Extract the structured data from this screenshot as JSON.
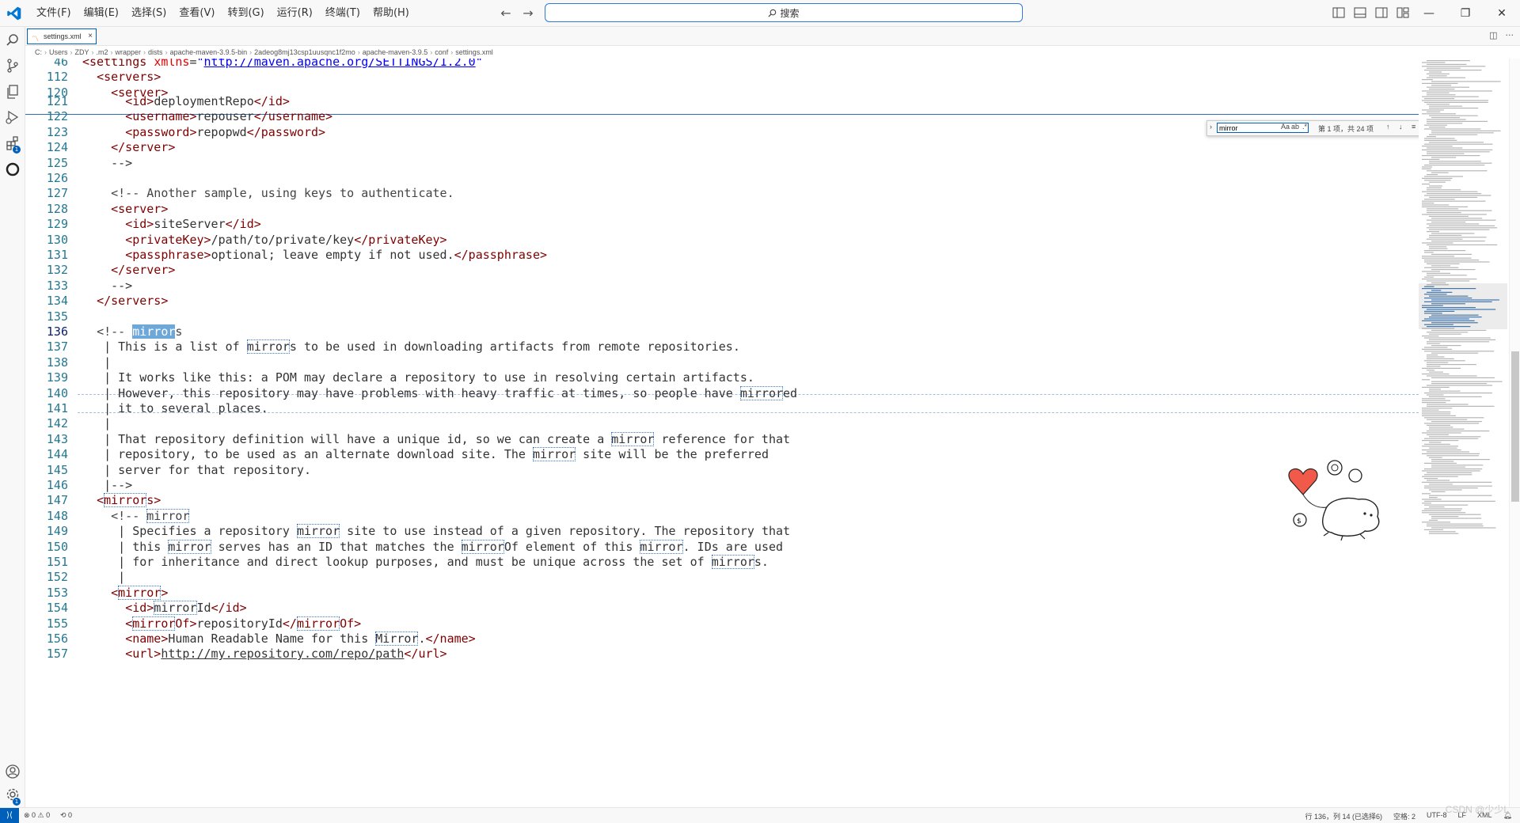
{
  "title_bar": {
    "menus": [
      "文件(F)",
      "编辑(E)",
      "选择(S)",
      "查看(V)",
      "转到(G)",
      "运行(R)",
      "终端(T)",
      "帮助(H)"
    ],
    "search_label": "搜索",
    "back_icon": "arrow-left-icon",
    "forward_icon": "arrow-right-icon"
  },
  "tab": {
    "label": "settings.xml",
    "icon": "xml-file-icon"
  },
  "breadcrumb": [
    "C:",
    "Users",
    "ZDY",
    ".m2",
    "wrapper",
    "dists",
    "apache-maven-3.9.5-bin",
    "2adeog8mj13csp1uusqnc1f2mo",
    "apache-maven-3.9.5",
    "conf",
    "settings.xml"
  ],
  "find": {
    "value": "mirror",
    "count": "第 1 项，共 24 项",
    "match_case": "Aa",
    "whole_word": "ab",
    "regex": ".*"
  },
  "sticky_lines": [
    {
      "num": "46",
      "html": "<span class=\"tag\">&lt;settings</span> <span class=\"attr\">xmlns</span>=<span class=\"str\">\"<u>http://maven.apache.org/SETTINGS/1.2.0</u>\"</span>"
    },
    {
      "num": "112",
      "html": "  <span class=\"tag\">&lt;servers&gt;</span>"
    },
    {
      "num": "120",
      "html": "    <span class=\"tag\">&lt;server&gt;</span>"
    }
  ],
  "lines": [
    {
      "num": "121",
      "html": "      <span class=\"tag\">&lt;id&gt;</span>deploymentRepo<span class=\"tag\">&lt;/id&gt;</span>"
    },
    {
      "num": "122",
      "html": "      <span class=\"tag\">&lt;username&gt;</span>repouser<span class=\"tag\">&lt;/username&gt;</span>"
    },
    {
      "num": "123",
      "html": "      <span class=\"tag\">&lt;password&gt;</span>repopwd<span class=\"tag\">&lt;/password&gt;</span>"
    },
    {
      "num": "124",
      "html": "    <span class=\"tag\">&lt;/server&gt;</span>"
    },
    {
      "num": "125",
      "html": "    -->"
    },
    {
      "num": "126",
      "html": ""
    },
    {
      "num": "127",
      "html": "    <span class=\"cm\">&lt;!-- Another sample, using keys to authenticate.</span>"
    },
    {
      "num": "128",
      "html": "    <span class=\"tag\">&lt;server&gt;</span>"
    },
    {
      "num": "129",
      "html": "      <span class=\"tag\">&lt;id&gt;</span>siteServer<span class=\"tag\">&lt;/id&gt;</span>"
    },
    {
      "num": "130",
      "html": "      <span class=\"tag\">&lt;privateKey&gt;</span>/path/to/private/key<span class=\"tag\">&lt;/privateKey&gt;</span>"
    },
    {
      "num": "131",
      "html": "      <span class=\"tag\">&lt;passphrase&gt;</span>optional; leave empty if not used.<span class=\"tag\">&lt;/passphrase&gt;</span>"
    },
    {
      "num": "132",
      "html": "    <span class=\"tag\">&lt;/server&gt;</span>"
    },
    {
      "num": "133",
      "html": "    -->"
    },
    {
      "num": "134",
      "html": "  <span class=\"tag\">&lt;/servers&gt;</span>"
    },
    {
      "num": "135",
      "html": ""
    },
    {
      "num": "136",
      "html": "  <span class=\"cm\">&lt;!-- <span class=\"hl-cur\">mirror</span>s</span>",
      "active": true
    },
    {
      "num": "137",
      "html": "   | This is a list of <span class=\"hl\">mirror</span>s to be used in downloading artifacts from remote repositories."
    },
    {
      "num": "138",
      "html": "   |"
    },
    {
      "num": "139",
      "html": "   | It works like this: a POM may declare a repository to use in resolving certain artifacts."
    },
    {
      "num": "140",
      "html": "   | However, this repository may have problems with heavy traffic at times, so people have <span class=\"hl\">mirror</span>ed"
    },
    {
      "num": "141",
      "html": "   | it to several places."
    },
    {
      "num": "142",
      "html": "   |"
    },
    {
      "num": "143",
      "html": "   | That repository definition will have a unique id, so we can create a <span class=\"hl\">mirror</span> reference for that"
    },
    {
      "num": "144",
      "html": "   | repository, to be used as an alternate download site. The <span class=\"hl\">mirror</span> site will be the preferred"
    },
    {
      "num": "145",
      "html": "   | server for that repository."
    },
    {
      "num": "146",
      "html": "   |-->"
    },
    {
      "num": "147",
      "html": "  <span class=\"tag\">&lt;<span class=\"hl\">mirror</span>s&gt;</span>"
    },
    {
      "num": "148",
      "html": "    <span class=\"cm\">&lt;!-- <span class=\"hl\">mirror</span></span>"
    },
    {
      "num": "149",
      "html": "     | Specifies a repository <span class=\"hl\">mirror</span> site to use instead of a given repository. The repository that"
    },
    {
      "num": "150",
      "html": "     | this <span class=\"hl\">mirror</span> serves has an ID that matches the <span class=\"hl\">mirror</span>Of element of this <span class=\"hl\">mirror</span>. IDs are used"
    },
    {
      "num": "151",
      "html": "     | for inheritance and direct lookup purposes, and must be unique across the set of <span class=\"hl\">mirror</span>s."
    },
    {
      "num": "152",
      "html": "     |"
    },
    {
      "num": "153",
      "html": "    <span class=\"tag\">&lt;<span class=\"hl\">mirror</span>&gt;</span>"
    },
    {
      "num": "154",
      "html": "      <span class=\"tag\">&lt;id&gt;</span><span class=\"hl\">mirror</span>Id<span class=\"tag\">&lt;/id&gt;</span>"
    },
    {
      "num": "155",
      "html": "      <span class=\"tag\">&lt;<span class=\"hl\">mirror</span>Of&gt;</span>repositoryId<span class=\"tag\">&lt;/<span class=\"hl\">mirror</span>Of&gt;</span>"
    },
    {
      "num": "156",
      "html": "      <span class=\"tag\">&lt;name&gt;</span>Human Readable Name for this <span class=\"hl\">Mirror</span>.<span class=\"tag\">&lt;/name&gt;</span>"
    },
    {
      "num": "157",
      "html": "      <span class=\"tag\">&lt;url&gt;</span><u>http://my.repository.com/repo/path</u><span class=\"tag\">&lt;/url&gt;</span>"
    }
  ],
  "status": {
    "remote": "⟩⟨",
    "problems": "⊗ 0 ⚠ 0",
    "ports": "⟲ 0",
    "position": "行 136，列 14 (已选择6)",
    "spaces": "空格: 2",
    "encoding": "UTF-8",
    "eol": "LF",
    "language": "XML"
  },
  "watermark": "CSDN @少少L"
}
